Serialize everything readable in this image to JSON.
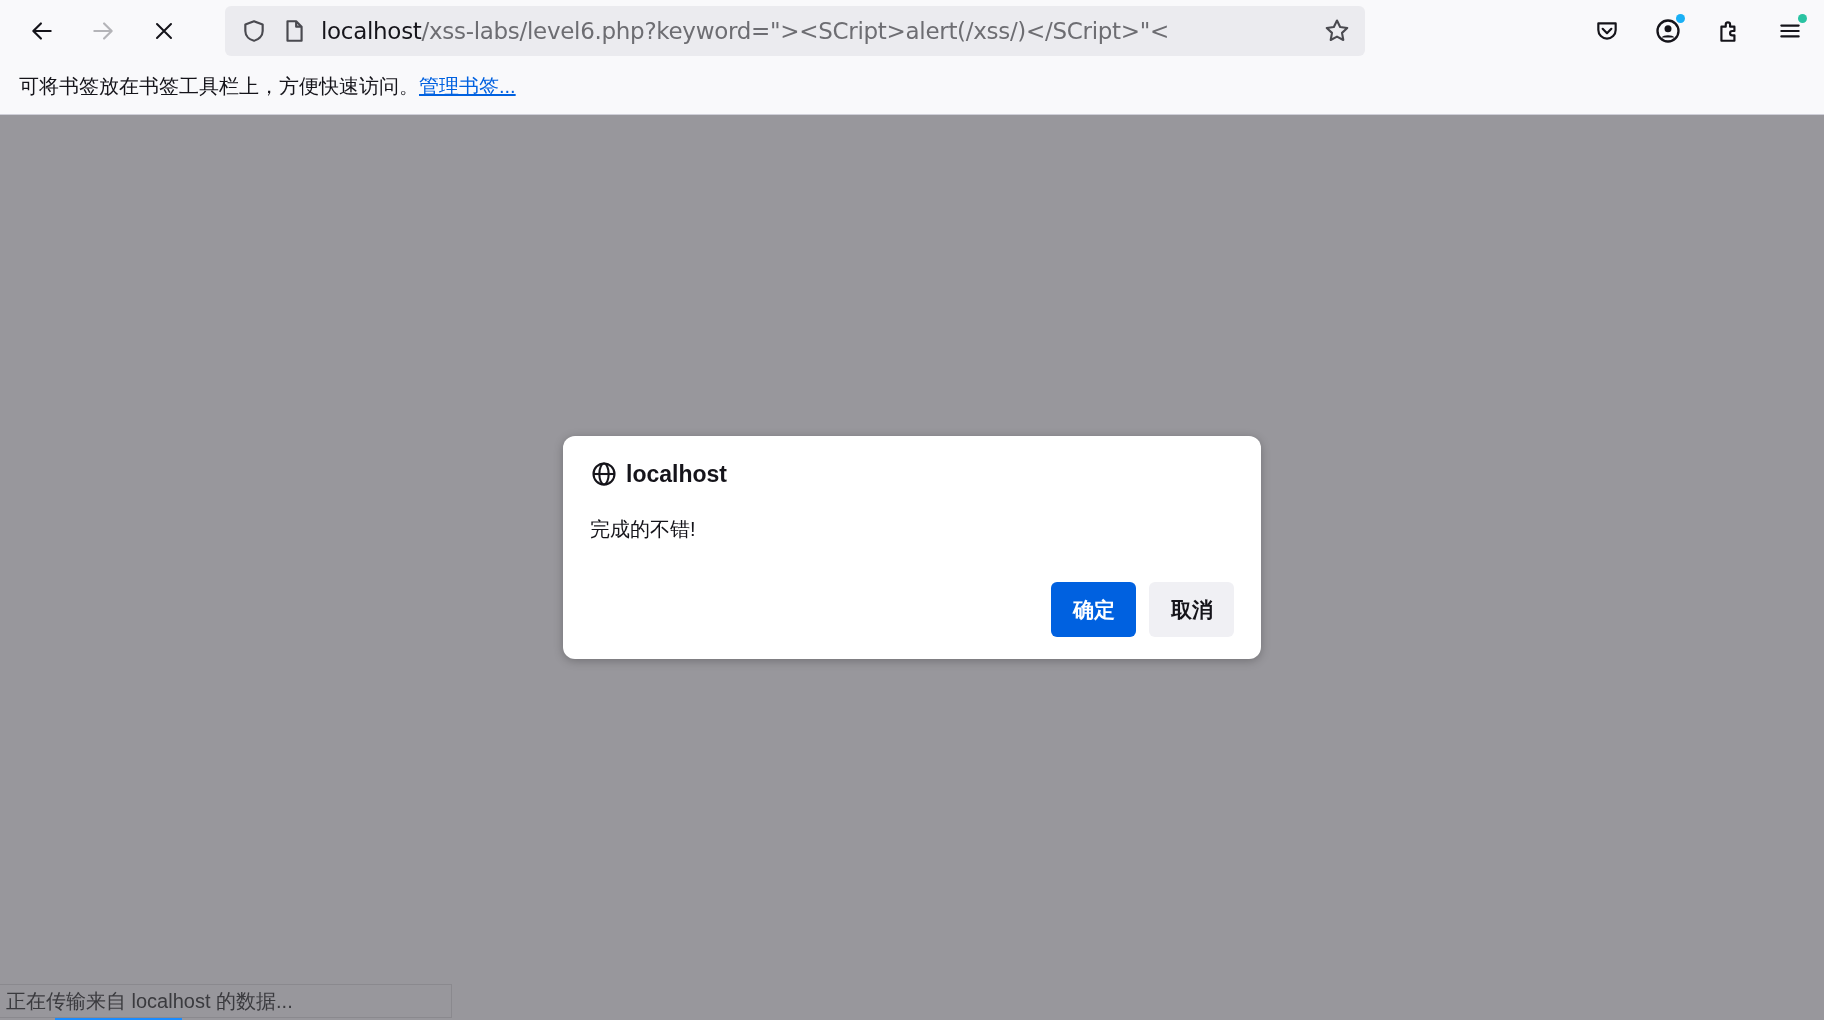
{
  "toolbar": {
    "back": {
      "disabled": false
    },
    "forward": {
      "disabled": true
    },
    "url": {
      "host": "localhost",
      "path": "/xss-labs/level6.php?keyword=\"><SCript>alert(/xss/)</SCript>\"<"
    },
    "account_badge": {
      "color": "#1ab0f5"
    },
    "menu_badge": {
      "color": "#2ac3a2"
    }
  },
  "bookmarks_bar": {
    "hint": "可将书签放在书签工具栏上，方便快速访问。",
    "link": "管理书签..."
  },
  "dialog": {
    "origin": "localhost",
    "message": "完成的不错!",
    "buttons": [
      {
        "label": "确定",
        "kind": "primary"
      },
      {
        "label": "取消",
        "kind": "secondary"
      }
    ]
  },
  "status_bar": {
    "text": "正在传输来自 localhost 的数据..."
  }
}
